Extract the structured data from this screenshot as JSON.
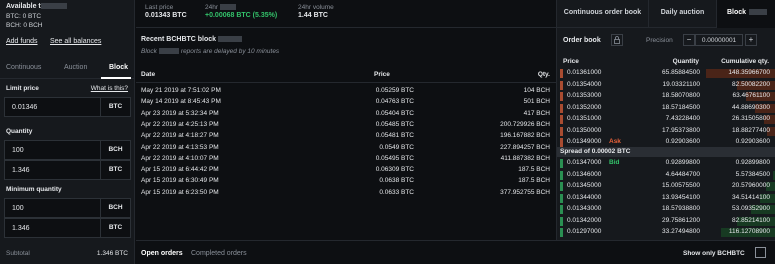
{
  "account": {
    "available_label": "Available t",
    "balances": [
      "BTC: 0 BTC",
      "BCH: 0 BCH"
    ],
    "add_funds": "Add funds",
    "see_all": "See all balances"
  },
  "form": {
    "tabs": [
      "Continuous",
      "Auction",
      "Block"
    ],
    "limit_price_label": "Limit price",
    "what_is_this": "What is this?",
    "limit_price_value": "0.01346",
    "limit_price_unit": "BTC",
    "quantity_label": "Quantity",
    "quantity_value": "100",
    "quantity_unit": "BCH",
    "quantity_btc_value": "1.346",
    "quantity_btc_unit": "BTC",
    "min_qty_label": "Minimum quantity",
    "min_qty_value": "100",
    "min_qty_unit": "BCH",
    "min_qty_btc_value": "1.346",
    "min_qty_btc_unit": "BTC",
    "subtotal_label": "Subtotal",
    "subtotal_value": "1.346 BTC"
  },
  "header": {
    "last_price_label": "Last price",
    "last_price_value": "0.01343 BTC",
    "change_label": "24hr",
    "change_value": "+0.00068 BTC (5.35%)",
    "volume_label": "24hr volume",
    "volume_value": "1.44 BTC",
    "tabs": [
      "Continuous order book",
      "Daily auction",
      "Block"
    ]
  },
  "block_trades": {
    "title": "Recent BCHBTC block",
    "subtitle_prefix": "Block",
    "subtitle_suffix": "reports are delayed by 10 minutes",
    "columns": [
      "Date",
      "Price",
      "Qty."
    ],
    "rows": [
      {
        "date": "May 21 2019 at 7:51:02 PM",
        "price": "0.05259 BTC",
        "qty": "104 BCH"
      },
      {
        "date": "May 14 2019 at 8:45:43 PM",
        "price": "0.04763 BTC",
        "qty": "501 BCH"
      },
      {
        "date": "Apr 23 2019 at 5:32:34 PM",
        "price": "0.05404 BTC",
        "qty": "417 BCH"
      },
      {
        "date": "Apr 22 2019 at 4:25:13 PM",
        "price": "0.05485 BTC",
        "qty": "200.729926 BCH"
      },
      {
        "date": "Apr 22 2019 at 4:18:27 PM",
        "price": "0.05481 BTC",
        "qty": "196.167882 BCH"
      },
      {
        "date": "Apr 22 2019 at 4:13:53 PM",
        "price": "0.0549 BTC",
        "qty": "227.894257 BCH"
      },
      {
        "date": "Apr 22 2019 at 4:10:07 PM",
        "price": "0.05495 BTC",
        "qty": "411.887382 BCH"
      },
      {
        "date": "Apr 15 2019 at 6:44:42 PM",
        "price": "0.06309 BTC",
        "qty": "187.5 BCH"
      },
      {
        "date": "Apr 15 2019 at 6:30:49 PM",
        "price": "0.0638 BTC",
        "qty": "187.5 BCH"
      },
      {
        "date": "Apr 15 2019 at 6:23:50 PM",
        "price": "0.0633 BTC",
        "qty": "377.952755 BCH"
      }
    ]
  },
  "bottom": {
    "tabs": [
      "Open orders",
      "Completed orders"
    ],
    "show_only": "Show only BCHBTC"
  },
  "order_book": {
    "title": "Order book",
    "precision_label": "Precision",
    "precision_minus": "−",
    "precision_value": "0.00000001",
    "precision_plus": "+",
    "columns": [
      "Price",
      "Quantity",
      "Cumulative qty."
    ],
    "asks": [
      {
        "price": "0.01361000",
        "qty": "65.85884500",
        "cum": "148.35966700",
        "depth": 1.0
      },
      {
        "price": "0.01354000",
        "qty": "19.03321100",
        "cum": "82.50082200",
        "depth": 0.556
      },
      {
        "price": "0.01353000",
        "qty": "18.58070800",
        "cum": "63.46761100",
        "depth": 0.428
      },
      {
        "price": "0.01352000",
        "qty": "18.57184500",
        "cum": "44.88690300",
        "depth": 0.303
      },
      {
        "price": "0.01351000",
        "qty": "7.43228400",
        "cum": "26.31505800",
        "depth": 0.177
      },
      {
        "price": "0.01350000",
        "qty": "17.95373800",
        "cum": "18.88277400",
        "depth": 0.127
      },
      {
        "price": "0.01349000",
        "qty": "0.92903600",
        "cum": "0.92903600",
        "depth": 0.006,
        "tag": "Ask"
      }
    ],
    "spread_label": "Spread of 0.00002 BTC",
    "bids": [
      {
        "price": "0.01347000",
        "qty": "0.92899800",
        "cum": "0.92899800",
        "depth": 0.006,
        "tag": "Bid"
      },
      {
        "price": "0.01346000",
        "qty": "4.64484700",
        "cum": "5.57384500",
        "depth": 0.038
      },
      {
        "price": "0.01345000",
        "qty": "15.00575500",
        "cum": "20.57960000",
        "depth": 0.139
      },
      {
        "price": "0.01344000",
        "qty": "13.93454100",
        "cum": "34.51414100",
        "depth": 0.233
      },
      {
        "price": "0.01343000",
        "qty": "18.57938800",
        "cum": "53.09352900",
        "depth": 0.358
      },
      {
        "price": "0.01342000",
        "qty": "29.75861200",
        "cum": "82.85214100",
        "depth": 0.558
      },
      {
        "price": "0.01297000",
        "qty": "33.27494800",
        "cum": "116.12708900",
        "depth": 0.783
      }
    ]
  },
  "colors": {
    "ask": "#e8623a",
    "bid": "#33c26a",
    "ask_bar": "#4a2418",
    "bid_bar": "#173a22"
  }
}
